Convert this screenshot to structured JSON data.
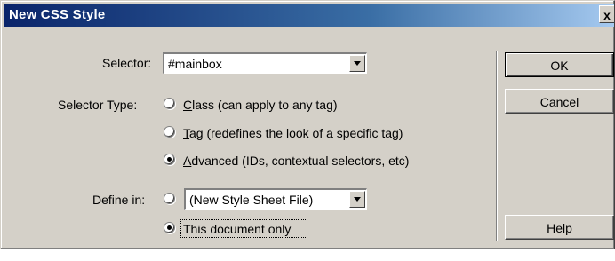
{
  "window": {
    "title": "New CSS Style",
    "close_symbol": "x"
  },
  "selector": {
    "label": "Selector:",
    "value": "#mainbox"
  },
  "selector_type": {
    "label": "Selector Type:",
    "options": [
      {
        "text": "Class (can apply to any tag)",
        "selected": false
      },
      {
        "text": "Tag (redefines the look of a specific tag)",
        "selected": false
      },
      {
        "text": "Advanced (IDs, contextual selectors, etc)",
        "selected": true
      }
    ]
  },
  "define_in": {
    "label": "Define in:",
    "file_value": "(New Style Sheet File)",
    "file_selected": false,
    "doc_text": "This document only",
    "doc_selected": true
  },
  "buttons": {
    "ok": "OK",
    "cancel": "Cancel",
    "help": "Help"
  }
}
